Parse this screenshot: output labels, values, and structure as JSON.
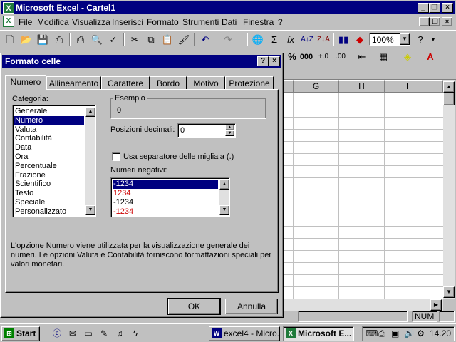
{
  "window": {
    "title": "Microsoft Excel - Cartel1"
  },
  "menubar": {
    "items": [
      "File",
      "Modifica",
      "Visualizza",
      "Inserisci",
      "Formato",
      "Strumenti",
      "Dati",
      "Finestra",
      "?"
    ]
  },
  "toolbar": {
    "zoom": "100%",
    "help": "?"
  },
  "grid": {
    "columns": [
      "G",
      "H",
      "I"
    ]
  },
  "status": {
    "num": "NUM"
  },
  "dialog": {
    "title": "Formato celle",
    "help": "?",
    "close": "×",
    "tabs": [
      "Numero",
      "Allineamento",
      "Carattere",
      "Bordo",
      "Motivo",
      "Protezione"
    ],
    "category_label": "Categoria:",
    "categories": [
      "Generale",
      "Numero",
      "Valuta",
      "Contabilità",
      "Data",
      "Ora",
      "Percentuale",
      "Frazione",
      "Scientifico",
      "Testo",
      "Speciale",
      "Personalizzato"
    ],
    "selected_category": "Numero",
    "sample_label": "Esempio",
    "sample_value": "0",
    "decimals_label": "Posizioni decimali:",
    "decimals_value": "0",
    "thousands_label": "Usa separatore delle migliaia (.)",
    "negative_label": "Numeri negativi:",
    "negatives": [
      {
        "text": "-1234",
        "color": "#000000"
      },
      {
        "text": "1234",
        "color": "#cc0000"
      },
      {
        "text": "-1234",
        "color": "#000000"
      },
      {
        "text": "-1234",
        "color": "#cc0000"
      }
    ],
    "description": "L'opzione Numero viene utilizzata per la visualizzazione generale dei numeri. Le opzioni Valuta e Contabilità forniscono formattazioni speciali per valori monetari.",
    "ok_label": "OK",
    "cancel_label": "Annulla"
  },
  "taskbar": {
    "start": "Start",
    "buttons": [
      "excel4 - Micro...",
      "Microsoft E..."
    ],
    "time": "14.20"
  },
  "colors": {
    "titlebar": "#000080",
    "face": "#c0c0c0",
    "desktop": "#008080"
  }
}
